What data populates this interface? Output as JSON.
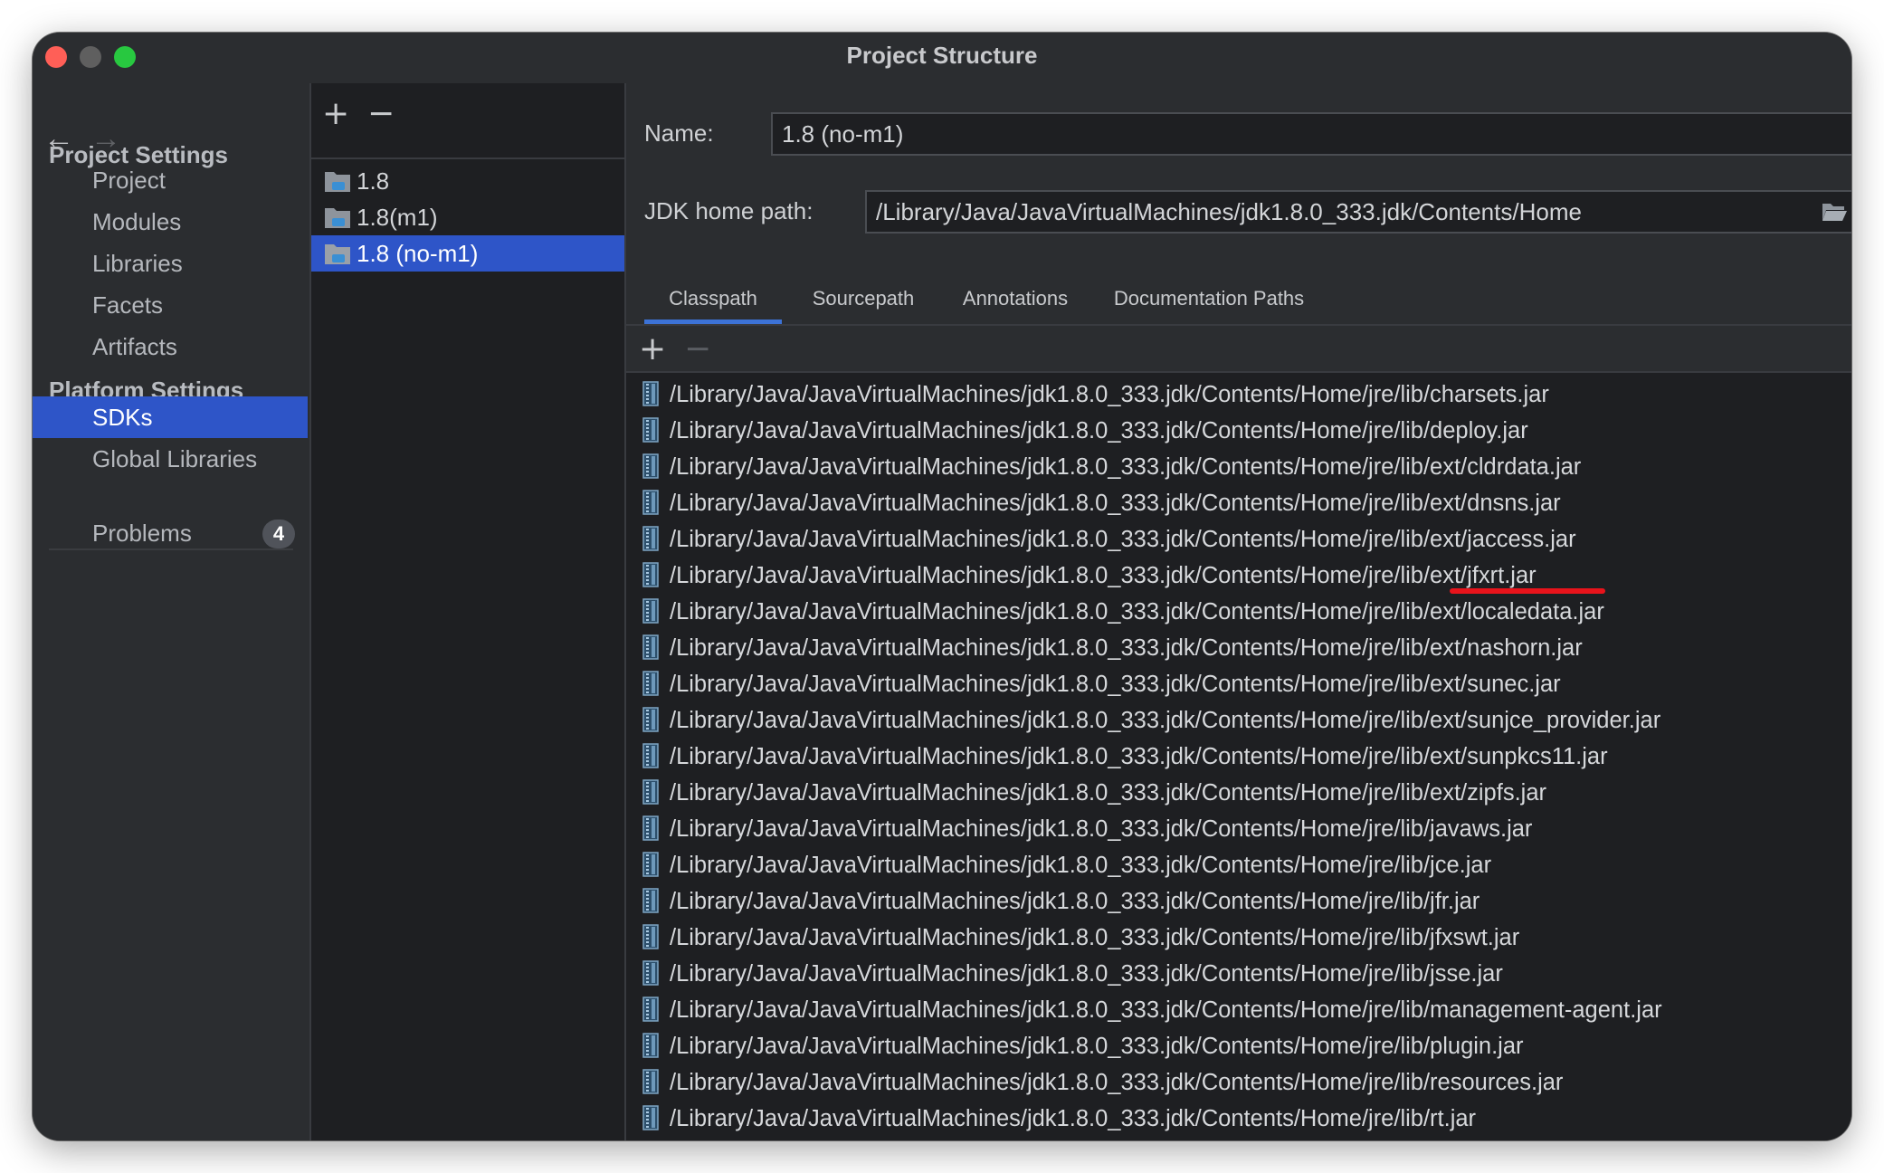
{
  "window": {
    "title": "Project Structure"
  },
  "sidebar": {
    "back_arrow": "←",
    "forward_arrow": "→",
    "project_settings_title": "Project Settings",
    "project_items": [
      "Project",
      "Modules",
      "Libraries",
      "Facets",
      "Artifacts"
    ],
    "platform_settings_title": "Platform Settings",
    "platform_items": [
      "SDKs",
      "Global Libraries"
    ],
    "selected_item": "SDKs",
    "problems_label": "Problems",
    "problems_count": "4"
  },
  "sdk_list": {
    "add_label": "+",
    "remove_label": "−",
    "items": [
      "1.8",
      "1.8(m1)",
      "1.8 (no-m1)"
    ],
    "selected_item": "1.8 (no-m1)"
  },
  "details": {
    "name_label": "Name:",
    "name_value": "1.8 (no-m1)",
    "jdk_home_label": "JDK home path:",
    "jdk_home_value": "/Library/Java/JavaVirtualMachines/jdk1.8.0_333.jdk/Contents/Home",
    "tabs": [
      "Classpath",
      "Sourcepath",
      "Annotations",
      "Documentation Paths"
    ],
    "active_tab": "Classpath",
    "list_add_label": "+",
    "list_remove_label": "−",
    "classpath": [
      "/Library/Java/JavaVirtualMachines/jdk1.8.0_333.jdk/Contents/Home/jre/lib/charsets.jar",
      "/Library/Java/JavaVirtualMachines/jdk1.8.0_333.jdk/Contents/Home/jre/lib/deploy.jar",
      "/Library/Java/JavaVirtualMachines/jdk1.8.0_333.jdk/Contents/Home/jre/lib/ext/cldrdata.jar",
      "/Library/Java/JavaVirtualMachines/jdk1.8.0_333.jdk/Contents/Home/jre/lib/ext/dnsns.jar",
      "/Library/Java/JavaVirtualMachines/jdk1.8.0_333.jdk/Contents/Home/jre/lib/ext/jaccess.jar",
      "/Library/Java/JavaVirtualMachines/jdk1.8.0_333.jdk/Contents/Home/jre/lib/ext/jfxrt.jar",
      "/Library/Java/JavaVirtualMachines/jdk1.8.0_333.jdk/Contents/Home/jre/lib/ext/localedata.jar",
      "/Library/Java/JavaVirtualMachines/jdk1.8.0_333.jdk/Contents/Home/jre/lib/ext/nashorn.jar",
      "/Library/Java/JavaVirtualMachines/jdk1.8.0_333.jdk/Contents/Home/jre/lib/ext/sunec.jar",
      "/Library/Java/JavaVirtualMachines/jdk1.8.0_333.jdk/Contents/Home/jre/lib/ext/sunjce_provider.jar",
      "/Library/Java/JavaVirtualMachines/jdk1.8.0_333.jdk/Contents/Home/jre/lib/ext/sunpkcs11.jar",
      "/Library/Java/JavaVirtualMachines/jdk1.8.0_333.jdk/Contents/Home/jre/lib/ext/zipfs.jar",
      "/Library/Java/JavaVirtualMachines/jdk1.8.0_333.jdk/Contents/Home/jre/lib/javaws.jar",
      "/Library/Java/JavaVirtualMachines/jdk1.8.0_333.jdk/Contents/Home/jre/lib/jce.jar",
      "/Library/Java/JavaVirtualMachines/jdk1.8.0_333.jdk/Contents/Home/jre/lib/jfr.jar",
      "/Library/Java/JavaVirtualMachines/jdk1.8.0_333.jdk/Contents/Home/jre/lib/jfxswt.jar",
      "/Library/Java/JavaVirtualMachines/jdk1.8.0_333.jdk/Contents/Home/jre/lib/jsse.jar",
      "/Library/Java/JavaVirtualMachines/jdk1.8.0_333.jdk/Contents/Home/jre/lib/management-agent.jar",
      "/Library/Java/JavaVirtualMachines/jdk1.8.0_333.jdk/Contents/Home/jre/lib/plugin.jar",
      "/Library/Java/JavaVirtualMachines/jdk1.8.0_333.jdk/Contents/Home/jre/lib/resources.jar",
      "/Library/Java/JavaVirtualMachines/jdk1.8.0_333.jdk/Contents/Home/jre/lib/rt.jar"
    ]
  },
  "colors": {
    "selection": "#2e55c8",
    "annotation_underline": "#e8131b",
    "tab_indicator": "#3c72d6"
  },
  "icons": {
    "sdk_item": "jdk-folder-icon",
    "classpath_item": "jar-archive-icon",
    "browse": "folder-open-icon"
  }
}
